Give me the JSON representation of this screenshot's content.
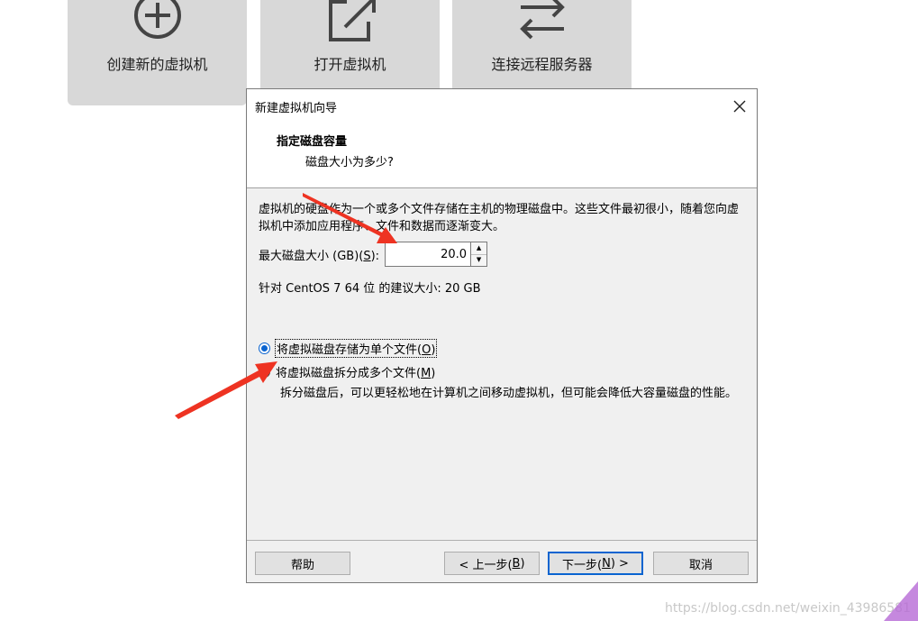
{
  "tiles": {
    "new_vm": "创建新的虚拟机",
    "open_vm": "打开虚拟机",
    "remote": "连接远程服务器"
  },
  "dialog": {
    "title": "新建虚拟机向导",
    "header_title": "指定磁盘容量",
    "header_subtitle": "磁盘大小为多少?",
    "description": "虚拟机的硬盘作为一个或多个文件存储在主机的物理磁盘中。这些文件最初很小，随着您向虚拟机中添加应用程序、文件和数据而逐渐变大。",
    "max_size_label": "最大磁盘大小 (GB)(",
    "max_size_hotkey": "S",
    "max_size_suffix": "):",
    "max_size_value": "20.0",
    "recommended": "针对 CentOS 7 64 位 的建议大小: 20 GB",
    "radio_single_label": "将虚拟磁盘存储为单个文件(",
    "radio_single_hotkey": "O",
    "radio_single_suffix": ")",
    "radio_multi_label": "将虚拟磁盘拆分成多个文件(",
    "radio_multi_hotkey": "M",
    "radio_multi_suffix": ")",
    "split_description": "拆分磁盘后，可以更轻松地在计算机之间移动虚拟机，但可能会降低大容量磁盘的性能。",
    "selected_option": "single"
  },
  "buttons": {
    "help": "帮助",
    "prev_prefix": "< 上一步(",
    "prev_hotkey": "B",
    "prev_suffix": ")",
    "next_prefix": "下一步(",
    "next_hotkey": "N",
    "next_suffix": ") >",
    "cancel": "取消"
  },
  "watermark": "https://blog.csdn.net/weixin_43986581",
  "colors": {
    "accent": "#0a64d0",
    "arrow": "#ee3322"
  },
  "icons": [
    "plus-circle-icon",
    "open-file-icon",
    "swap-arrows-icon",
    "close-icon",
    "spin-up-icon",
    "spin-down-icon"
  ]
}
